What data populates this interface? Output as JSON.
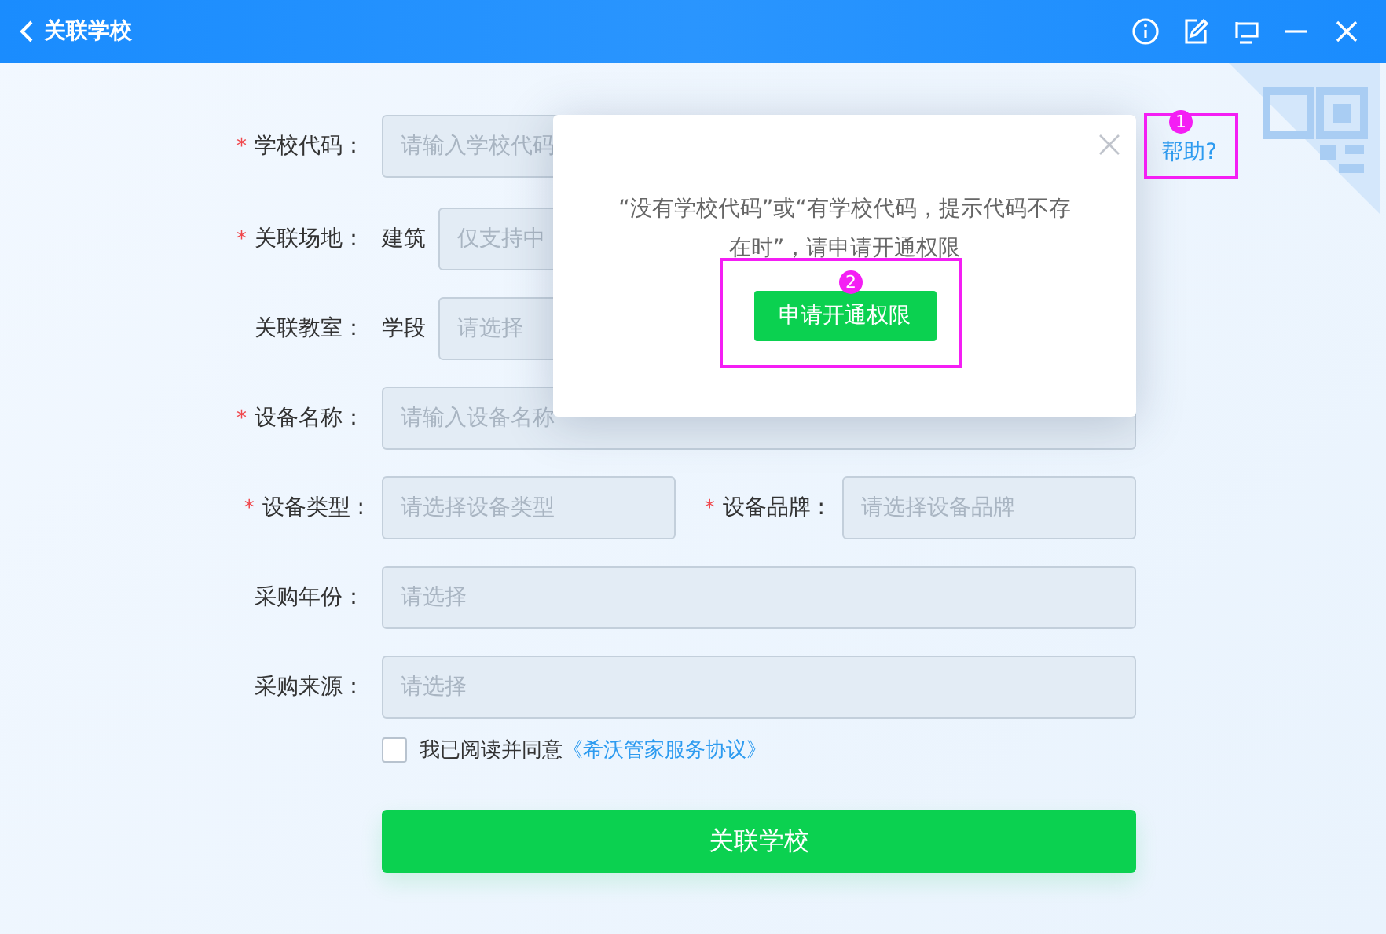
{
  "window": {
    "title": "关联学校"
  },
  "form": {
    "required_mark": "*",
    "rows": [
      {
        "kind": "input",
        "label": "学校代码：",
        "required": true,
        "placeholder": "请输入学校代码"
      },
      {
        "kind": "select",
        "label": "关联场地：",
        "required": true,
        "prefix": "建筑",
        "placeholder": "仅支持中"
      },
      {
        "kind": "select",
        "label": "关联教室：",
        "required": false,
        "prefix": "学段",
        "placeholder": "请选择"
      },
      {
        "kind": "input",
        "label": "设备名称：",
        "required": true,
        "placeholder": "请输入设备名称"
      },
      {
        "kind": "pair",
        "fields": [
          {
            "label": "设备类型 :",
            "required": true,
            "placeholder": "请选择设备类型"
          },
          {
            "label": "设备品牌 :",
            "required": true,
            "placeholder": "请选择设备品牌"
          }
        ]
      },
      {
        "kind": "select",
        "label": "采购年份：",
        "required": false,
        "placeholder": "请选择"
      },
      {
        "kind": "select",
        "label": "采购来源：",
        "required": false,
        "placeholder": "请选择"
      }
    ],
    "agreement": {
      "checked": false,
      "text": "我已阅读并同意",
      "link": "《希沃管家服务协议》"
    },
    "submit": "关联学校"
  },
  "help_link": "帮助?",
  "dialog": {
    "message": "“没有学校代码”或“有学校代码，提示代码不存在时”，请申请开通权限",
    "button": "申请开通权限"
  },
  "annotations": [
    {
      "label": "1"
    },
    {
      "label": "2"
    }
  ]
}
